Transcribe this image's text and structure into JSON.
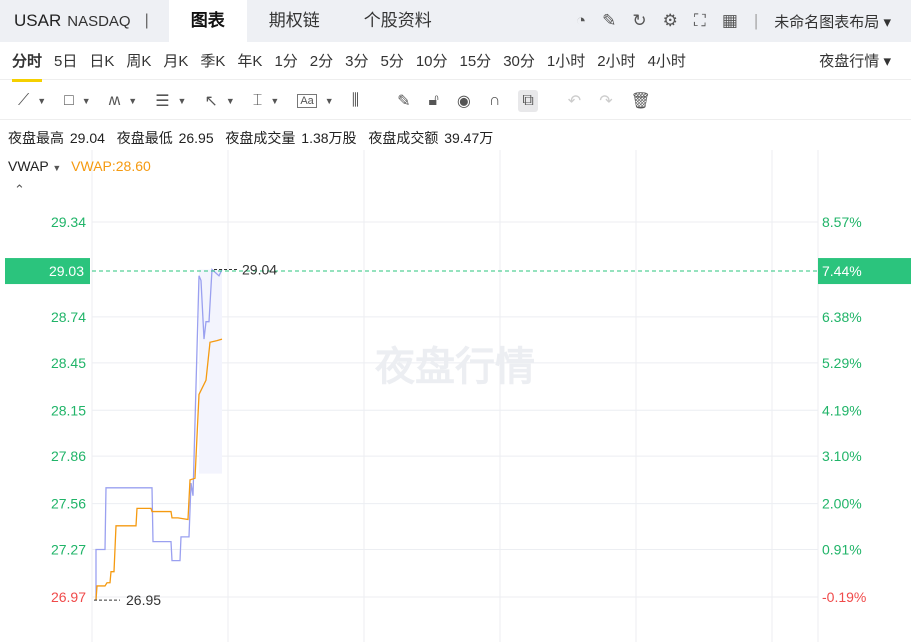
{
  "header": {
    "symbol": "USAR",
    "exchange": "NASDAQ",
    "separator": "|",
    "tabs": [
      "图表",
      "期权链",
      "个股资料"
    ],
    "layout": "未命名图表布局 ▾"
  },
  "icons": [
    "gauge-icon",
    "edit-icon",
    "refresh-icon",
    "settings-icon",
    "fullscreen-icon",
    "grid-icon"
  ],
  "periods": [
    "分时",
    "5日",
    "日K",
    "周K",
    "月K",
    "季K",
    "年K",
    "1分",
    "2分",
    "3分",
    "5分",
    "10分",
    "15分",
    "30分",
    "1小时",
    "2小时",
    "4小时"
  ],
  "night_mode": "夜盘行情 ▾",
  "stats": "夜盘最高 29.04  夜盘最低 26.95  夜盘成交量 1.38万股  夜盘成交额 39.47万",
  "indicator": {
    "name": "VWAP",
    "value": "VWAP:28.60"
  },
  "watermark": "夜盘行情",
  "colors": {
    "up": "#20b468",
    "down": "#f04a4a",
    "price_line": "#9aa0f0",
    "vwap": "#f59a10",
    "current": "#2bc47d"
  },
  "chart_data": {
    "type": "line",
    "y_ticks": [
      "29.34",
      "28.74",
      "28.45",
      "28.15",
      "27.86",
      "27.56",
      "27.27",
      "26.97"
    ],
    "y_tick_values": [
      29.34,
      28.74,
      28.45,
      28.15,
      27.86,
      27.56,
      27.27,
      26.97
    ],
    "pct_ticks": [
      "8.57%",
      "6.38%",
      "5.29%",
      "4.19%",
      "3.10%",
      "2.00%",
      "0.91%",
      "-0.19%"
    ],
    "current_price": "29.03",
    "current_value": 29.03,
    "current_pct": "7.44%",
    "high_label": "29.04",
    "low_label": "26.95",
    "ylim": [
      26.97,
      29.34
    ],
    "series": [
      {
        "name": "price",
        "points": [
          [
            4,
            26.95
          ],
          [
            4,
            27.27
          ],
          [
            13,
            27.27
          ],
          [
            14,
            27.66
          ],
          [
            60,
            27.66
          ],
          [
            61,
            27.32
          ],
          [
            79,
            27.32
          ],
          [
            80,
            27.2
          ],
          [
            88,
            27.2
          ],
          [
            89,
            27.35
          ],
          [
            97,
            27.35
          ],
          [
            99,
            27.69
          ],
          [
            101,
            27.61
          ],
          [
            107,
            29.0
          ],
          [
            109,
            28.97
          ],
          [
            112,
            28.6
          ],
          [
            114,
            28.71
          ],
          [
            117,
            28.71
          ],
          [
            120,
            29.04
          ],
          [
            127,
            29.0
          ],
          [
            130,
            29.04
          ]
        ]
      },
      {
        "name": "VWAP",
        "points": [
          [
            4,
            26.95
          ],
          [
            5,
            27.04
          ],
          [
            13,
            27.04
          ],
          [
            15,
            27.06
          ],
          [
            18,
            27.06
          ],
          [
            19,
            27.13
          ],
          [
            22,
            27.13
          ],
          [
            24,
            27.42
          ],
          [
            44,
            27.42
          ],
          [
            45,
            27.53
          ],
          [
            59,
            27.53
          ],
          [
            60,
            27.51
          ],
          [
            79,
            27.51
          ],
          [
            80,
            27.47
          ],
          [
            86,
            27.47
          ],
          [
            96,
            27.46
          ],
          [
            98,
            27.71
          ],
          [
            103,
            27.72
          ],
          [
            107,
            28.25
          ],
          [
            114,
            28.34
          ],
          [
            118,
            28.58
          ],
          [
            125,
            28.59
          ],
          [
            130,
            28.6
          ]
        ]
      }
    ]
  }
}
